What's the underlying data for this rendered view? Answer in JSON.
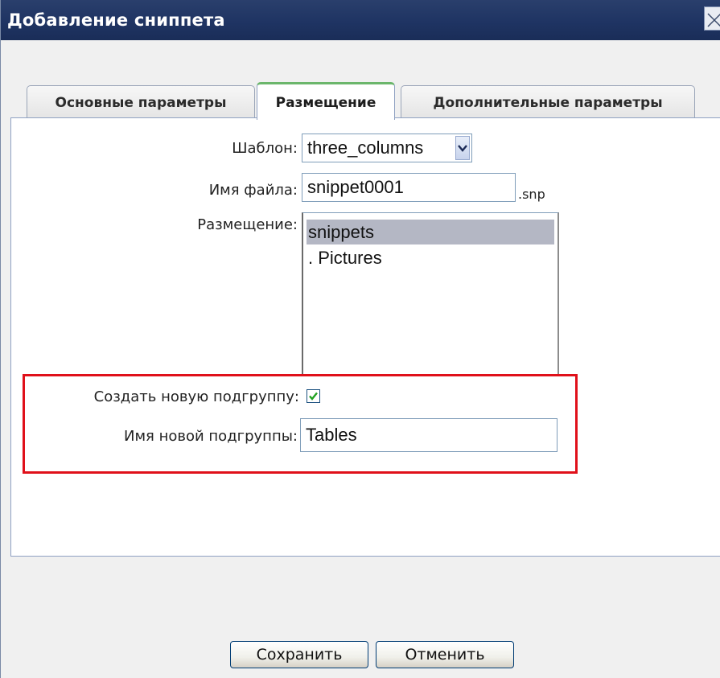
{
  "window": {
    "title": "Добавление сниппета"
  },
  "tabs": [
    {
      "label": "Основные параметры",
      "active": false
    },
    {
      "label": "Размещение",
      "active": true
    },
    {
      "label": "Дополнительные параметры",
      "active": false
    }
  ],
  "form": {
    "template_label": "Шаблон:",
    "template_value": "three_columns",
    "filename_label": "Имя файла:",
    "filename_value": "snippet0001",
    "filename_ext": ".snp",
    "placement_label": "Размещение:",
    "placement_options": [
      "snippets",
      ". Pictures"
    ],
    "placement_selected": "snippets",
    "create_subgroup_label": "Создать новую подгруппу:",
    "create_subgroup_checked": true,
    "subgroup_name_label": "Имя новой подгруппы:",
    "subgroup_name_value": "Tables"
  },
  "buttons": {
    "save": "Сохранить",
    "cancel": "Отменить"
  },
  "colors": {
    "titlebar": "#1f3463",
    "active_tab_accent": "#6bb66b",
    "highlight_border": "#e0101a",
    "selected_option": "#b4b7c4"
  }
}
